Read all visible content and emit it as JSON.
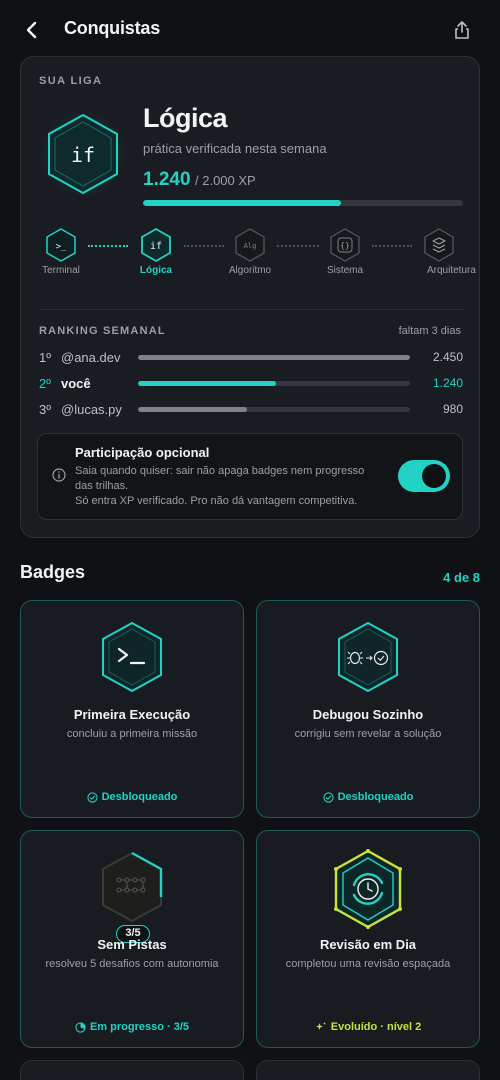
{
  "header": {
    "title": "Conquistas",
    "back_icon": "chevron-left-icon",
    "share_icon": "share-icon"
  },
  "league": {
    "section_label": "SUA LIGA",
    "icon_text": "if",
    "name": "Lógica",
    "subtitle": "prática verificada nesta semana",
    "xp_current": "1.240",
    "xp_total": "/ 2.000 XP",
    "xp_progress": 0.62,
    "tiers": [
      {
        "label": "Terminal",
        "glyph": ">_",
        "state": "done"
      },
      {
        "label": "Lógica",
        "glyph": "if",
        "state": "active"
      },
      {
        "label": "Algoritmo",
        "glyph": "Alg",
        "state": "locked"
      },
      {
        "label": "Sistema",
        "glyph": "{}",
        "state": "locked"
      },
      {
        "label": "Arquitetura",
        "glyph": "layers",
        "state": "locked"
      }
    ]
  },
  "ranking": {
    "label": "RANKING SEMANAL",
    "days_left": "faltam 3 dias",
    "rows": [
      {
        "pos": "1º",
        "name": "@ana.dev",
        "xp": "2.450",
        "fill": 1.0,
        "me": false
      },
      {
        "pos": "2º",
        "name": "você",
        "xp": "1.240",
        "fill": 0.506,
        "me": true
      },
      {
        "pos": "3º",
        "name": "@lucas.py",
        "xp": "980",
        "fill": 0.4,
        "me": false
      }
    ]
  },
  "optional": {
    "title": "Participação opcional",
    "line1": "Saia quando quiser: sair não apaga badges nem progresso das trilhas.",
    "line2": "Só entra XP verificado. Pro não dá vantagem competitiva.",
    "toggle_on": true
  },
  "badges": {
    "title": "Badges",
    "count": "4 de 8",
    "items": [
      {
        "name": "Primeira Execução",
        "desc": "concluiu a primeira missão",
        "status": "Desbloqueado",
        "state": "unlocked",
        "icon": "terminal-icon"
      },
      {
        "name": "Debugou Sozinho",
        "desc": "corrigiu sem revelar a solução",
        "status": "Desbloqueado",
        "state": "unlocked",
        "icon": "bug-check-icon"
      },
      {
        "name": "Sem Pistas",
        "desc": "resolveu 5 desafios com autonomia",
        "status": "Em progresso · 3/5",
        "state": "progress",
        "progress_label": "3/5",
        "progress": 0.6,
        "icon": "circuit-icon"
      },
      {
        "name": "Revisão em Dia",
        "desc": "completou uma revisão espaçada",
        "status": "Evoluído · nível 2",
        "state": "evolved",
        "icon": "clock-icon"
      }
    ]
  },
  "colors": {
    "accent": "#22d3c5",
    "evolved": "#c4e33c",
    "background": "#0f1114",
    "card": "#191c20"
  }
}
